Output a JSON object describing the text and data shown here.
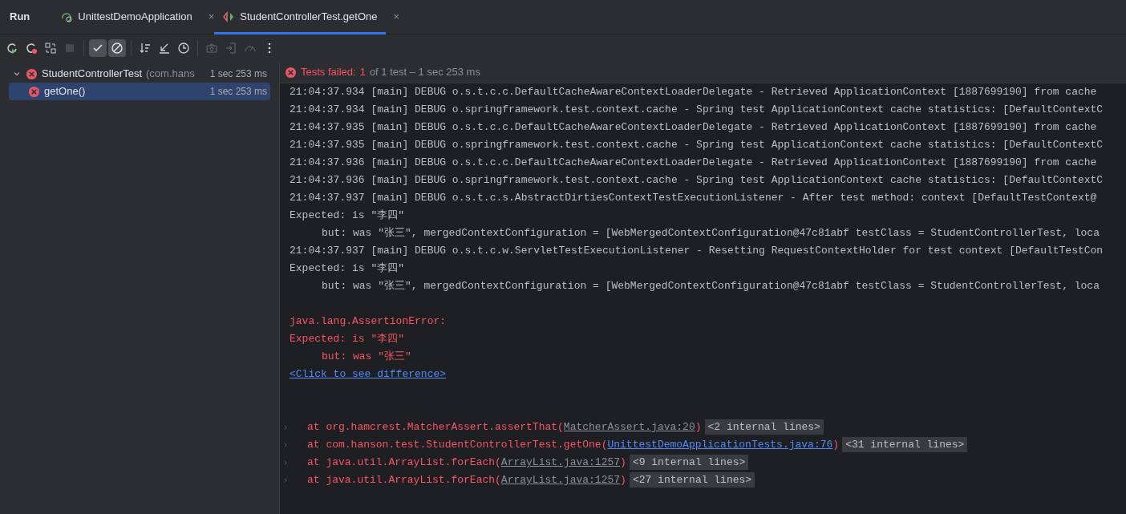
{
  "tool_window": {
    "title": "Run",
    "tabs": [
      {
        "label": "UnittestDemoApplication",
        "kind": "app",
        "close": "×",
        "selected": false
      },
      {
        "label": "StudentControllerTest.getOne",
        "kind": "test",
        "close": "×",
        "selected": true
      }
    ]
  },
  "toolbar": [
    {
      "kind": "rerun",
      "on": false,
      "disabled": false
    },
    {
      "kind": "rerun-failed",
      "on": false,
      "disabled": false
    },
    {
      "kind": "toggle-auto",
      "on": false,
      "disabled": false
    },
    {
      "kind": "stop",
      "on": false,
      "disabled": true
    },
    {
      "kind": "sep"
    },
    {
      "kind": "show-passed",
      "on": true,
      "disabled": false
    },
    {
      "kind": "show-ignored",
      "on": true,
      "disabled": false
    },
    {
      "kind": "sep"
    },
    {
      "kind": "sort",
      "on": false,
      "disabled": false
    },
    {
      "kind": "collapse",
      "on": false,
      "disabled": false
    },
    {
      "kind": "history",
      "on": false,
      "disabled": false
    },
    {
      "kind": "sep"
    },
    {
      "kind": "camera",
      "on": false,
      "disabled": true
    },
    {
      "kind": "import",
      "on": false,
      "disabled": true
    },
    {
      "kind": "gauge",
      "on": false,
      "disabled": true
    },
    {
      "kind": "more",
      "on": false,
      "disabled": false
    }
  ],
  "test_tree": [
    {
      "label": "StudentControllerTest",
      "package": "(com.hans",
      "time": "1 sec 253 ms",
      "kind": "failed",
      "expanded": true,
      "selected": false,
      "children": [
        {
          "label": "getOne()",
          "time": "1 sec 253 ms",
          "kind": "failed",
          "selected": true
        }
      ]
    }
  ],
  "status": {
    "label": "Tests failed:",
    "count": "1",
    "detail": "of 1 test – 1 sec 253 ms"
  },
  "console": [
    {
      "kind": "log",
      "text": "21:04:37.934 [main] DEBUG o.s.t.c.c.DefaultCacheAwareContextLoaderDelegate - Retrieved ApplicationContext [1887699190] from cache"
    },
    {
      "kind": "log",
      "text": "21:04:37.934 [main] DEBUG o.springframework.test.context.cache - Spring test ApplicationContext cache statistics: [DefaultContextC"
    },
    {
      "kind": "log",
      "text": "21:04:37.935 [main] DEBUG o.s.t.c.c.DefaultCacheAwareContextLoaderDelegate - Retrieved ApplicationContext [1887699190] from cache"
    },
    {
      "kind": "log",
      "text": "21:04:37.935 [main] DEBUG o.springframework.test.context.cache - Spring test ApplicationContext cache statistics: [DefaultContextC"
    },
    {
      "kind": "log",
      "text": "21:04:37.936 [main] DEBUG o.s.t.c.c.DefaultCacheAwareContextLoaderDelegate - Retrieved ApplicationContext [1887699190] from cache"
    },
    {
      "kind": "log",
      "text": "21:04:37.936 [main] DEBUG o.springframework.test.context.cache - Spring test ApplicationContext cache statistics: [DefaultContextC"
    },
    {
      "kind": "log",
      "text": "21:04:37.937 [main] DEBUG o.s.t.c.s.AbstractDirtiesContextTestExecutionListener - After test method: context [DefaultTestContext@"
    },
    {
      "kind": "log",
      "text": "Expected: is \"李四\""
    },
    {
      "kind": "log-indent",
      "text": "but: was \"张三\", mergedContextConfiguration = [WebMergedContextConfiguration@47c81abf testClass = StudentControllerTest, loca"
    },
    {
      "kind": "log",
      "text": "21:04:37.937 [main] DEBUG o.s.t.c.w.ServletTestExecutionListener - Resetting RequestContextHolder for test context [DefaultTestCon"
    },
    {
      "kind": "log",
      "text": "Expected: is \"李四\""
    },
    {
      "kind": "log-indent",
      "text": "but: was \"张三\", mergedContextConfiguration = [WebMergedContextConfiguration@47c81abf testClass = StudentControllerTest, loca"
    },
    {
      "kind": "blank"
    },
    {
      "kind": "error",
      "text": "java.lang.AssertionError:"
    },
    {
      "kind": "error",
      "text": "Expected: is \"李四\""
    },
    {
      "kind": "error-indent",
      "text": "but: was \"张三\""
    },
    {
      "kind": "link",
      "text": "<Click to see difference>"
    },
    {
      "kind": "blank"
    },
    {
      "kind": "blank"
    }
  ],
  "stack": [
    {
      "text": "at org.hamcrest.MatcherAssert.assertThat(",
      "source": "MatcherAssert.java:20",
      "kind": "library",
      "close": ")",
      "folded": "<2 internal lines>"
    },
    {
      "text": "at com.hanson.test.StudentControllerTest.getOne(",
      "source": "UnittestDemoApplicationTests.java:76",
      "kind": "project",
      "close": ")",
      "folded": "<31 internal lines>"
    },
    {
      "text": "at java.util.ArrayList.forEach(",
      "source": "ArrayList.java:1257",
      "kind": "library",
      "close": ")",
      "folded": "<9 internal lines>"
    },
    {
      "text": "at java.util.ArrayList.forEach(",
      "source": "ArrayList.java:1257",
      "kind": "library",
      "close": ")",
      "folded": "<27 internal lines>"
    }
  ]
}
